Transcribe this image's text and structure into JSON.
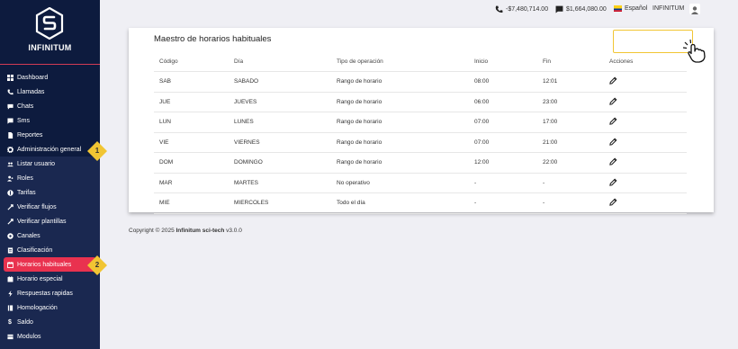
{
  "brand": {
    "name": "INFINITUM"
  },
  "colors": {
    "sidebar": "#0d1b3e",
    "accent": "#e9324f",
    "callout": "#f1c533"
  },
  "sidebar": {
    "items": [
      {
        "label": "Dashboard",
        "icon": "dashboard-icon"
      },
      {
        "label": "Llamadas",
        "icon": "phone-icon"
      },
      {
        "label": "Chats",
        "icon": "chat-icon"
      },
      {
        "label": "Sms",
        "icon": "sms-icon"
      },
      {
        "label": "Reportes",
        "icon": "report-icon"
      },
      {
        "label": "Administración general",
        "icon": "gear-icon"
      }
    ],
    "subitems": [
      {
        "label": "Listar usuario",
        "icon": "users-icon"
      },
      {
        "label": "Roles",
        "icon": "roles-icon"
      },
      {
        "label": "Tarifas",
        "icon": "tariff-icon"
      },
      {
        "label": "Verificar flujos",
        "icon": "flow-icon"
      },
      {
        "label": "Verificar plantillas",
        "icon": "template-icon"
      },
      {
        "label": "Canales",
        "icon": "channel-icon"
      },
      {
        "label": "Clasificación",
        "icon": "classification-icon"
      },
      {
        "label": "Horarios habituales",
        "icon": "calendar-icon",
        "active": true
      },
      {
        "label": "Horario especial",
        "icon": "special-schedule-icon"
      },
      {
        "label": "Respuestas rapidas",
        "icon": "bolt-icon"
      },
      {
        "label": "Homologación",
        "icon": "homologation-icon"
      },
      {
        "label": "Saldo",
        "icon": "dollar-icon"
      },
      {
        "label": "Modulos",
        "icon": "modules-icon"
      }
    ],
    "callouts": [
      "1",
      "2"
    ]
  },
  "header": {
    "balance_negative": "-$7,480,714.00",
    "balance_chat": "$1,664,080.00",
    "language": "Español",
    "user": "INFINITUM"
  },
  "page": {
    "title": "Maestro de horarios habituales"
  },
  "table": {
    "headers": [
      "Código",
      "Día",
      "Tipo de operación",
      "Inicio",
      "Fin",
      "Acciones"
    ],
    "rows": [
      [
        "SAB",
        "SABADO",
        "Rango de horario",
        "08:00",
        "12:01"
      ],
      [
        "JUE",
        "JUEVES",
        "Rango de horario",
        "06:00",
        "23:00"
      ],
      [
        "LUN",
        "LUNES",
        "Rango de horario",
        "07:00",
        "17:00"
      ],
      [
        "VIE",
        "VIERNES",
        "Rango de horario",
        "07:00",
        "21:00"
      ],
      [
        "DOM",
        "DOMINGO",
        "Rango de horario",
        "12:00",
        "22:00"
      ],
      [
        "MAR",
        "MARTES",
        "No operativo",
        "-",
        "-"
      ],
      [
        "MIE",
        "MIERCOLES",
        "Todo el día",
        "-",
        "-"
      ]
    ]
  },
  "footer": {
    "prefix": "Copyright © 2025",
    "company": "Infinitum sci-tech",
    "version": "v3.0.0"
  }
}
